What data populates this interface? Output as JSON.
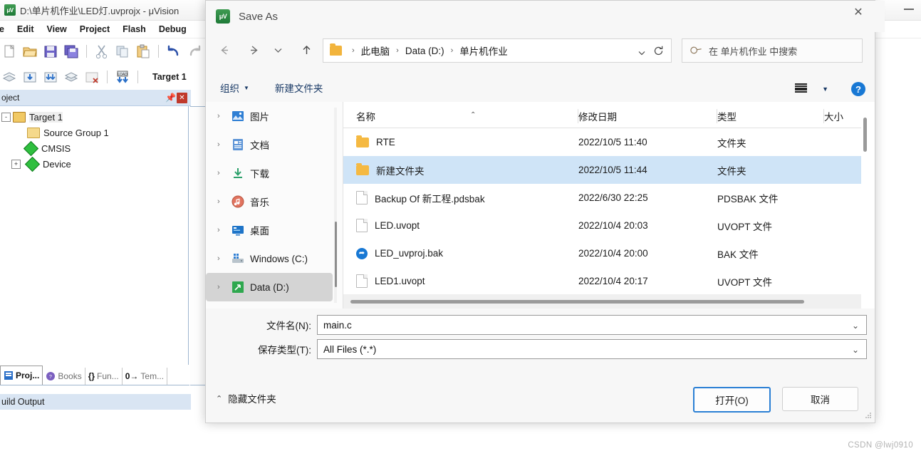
{
  "background_app": {
    "title": "D:\\单片机作业\\LED灯.uvprojx - μVision",
    "icon": "keil-uvision-icon",
    "minimize_label": "—",
    "menu": [
      "ile",
      "Edit",
      "View",
      "Project",
      "Flash",
      "Debug"
    ],
    "toolbar2_label": "Target 1",
    "project_panel": {
      "title": "oject",
      "pin_icon": "pin-icon",
      "close_icon": "close-icon",
      "tree": [
        {
          "label": "Target 1",
          "expander": "-",
          "icon": "target-folder-icon",
          "indent": 0,
          "selected": true
        },
        {
          "label": "Source Group 1",
          "expander": "",
          "icon": "folder-icon",
          "indent": 1,
          "selected": false
        },
        {
          "label": "CMSIS",
          "expander": "",
          "icon": "component-diamond-icon",
          "indent": 1,
          "selected": false
        },
        {
          "label": "Device",
          "expander": "+",
          "icon": "component-diamond-icon",
          "indent": 1,
          "selected": false
        }
      ]
    },
    "tabs": [
      {
        "label": "Proj...",
        "icon": "project-icon",
        "active": true
      },
      {
        "label": "Books",
        "icon": "books-icon",
        "active": false
      },
      {
        "label": "Fun...",
        "icon": "functions-icon",
        "active": false
      },
      {
        "label": "Tem...",
        "icon": "templates-icon",
        "active": false
      }
    ],
    "build_output_label": "uild Output"
  },
  "dialog": {
    "title": "Save As",
    "icon": "keil-uvision-icon",
    "close_icon": "close-icon",
    "nav": {
      "back_icon": "arrow-left-icon",
      "forward_icon": "arrow-right-icon",
      "recent_icon": "chevron-down-icon",
      "up_icon": "arrow-up-icon"
    },
    "address": {
      "folder_icon": "folder-icon",
      "crumbs": [
        "此电脑",
        "Data (D:)",
        "单片机作业"
      ],
      "separator": "›",
      "dropdown_icon": "chevron-down-icon",
      "refresh_icon": "refresh-icon"
    },
    "search": {
      "icon": "search-icon",
      "placeholder": "在 单片机作业 中搜索"
    },
    "commandbar": {
      "organize_label": "组织",
      "organize_caret": "▼",
      "new_folder_label": "新建文件夹",
      "view_icon": "view-list-icon",
      "view_caret": "▼",
      "help_icon": "help-icon",
      "help_label": "?"
    },
    "navpane": {
      "items": [
        {
          "label": "图片",
          "icon": "pictures-icon",
          "chevron": "›",
          "selected": false
        },
        {
          "label": "文档",
          "icon": "documents-icon",
          "chevron": "›",
          "selected": false
        },
        {
          "label": "下载",
          "icon": "downloads-icon",
          "chevron": "›",
          "selected": false
        },
        {
          "label": "音乐",
          "icon": "music-icon",
          "chevron": "›",
          "selected": false
        },
        {
          "label": "桌面",
          "icon": "desktop-icon",
          "chevron": "›",
          "selected": false
        },
        {
          "label": "Windows (C:)",
          "icon": "drive-icon",
          "chevron": "›",
          "selected": false
        },
        {
          "label": "Data (D:)",
          "icon": "drive-green-icon",
          "chevron": "›",
          "selected": true
        }
      ]
    },
    "filelist": {
      "columns": [
        "名称",
        "修改日期",
        "类型",
        "大小"
      ],
      "sort_caret": "⌃",
      "rows": [
        {
          "name": "RTE",
          "date": "2022/10/5 11:40",
          "type": "文件夹",
          "size": "",
          "icon": "folder-icon",
          "selected": false
        },
        {
          "name": "新建文件夹",
          "date": "2022/10/5 11:44",
          "type": "文件夹",
          "size": "",
          "icon": "folder-icon",
          "selected": true
        },
        {
          "name": "Backup Of 新工程.pdsbak",
          "date": "2022/6/30 22:25",
          "type": "PDSBAK 文件",
          "size": "",
          "icon": "file-icon",
          "selected": false
        },
        {
          "name": "LED.uvopt",
          "date": "2022/10/4 20:03",
          "type": "UVOPT 文件",
          "size": "",
          "icon": "file-icon",
          "selected": false
        },
        {
          "name": "LED_uvproj.bak",
          "date": "2022/10/4 20:00",
          "type": "BAK 文件",
          "size": "",
          "icon": "bak-icon",
          "selected": false
        },
        {
          "name": "LED1.uvopt",
          "date": "2022/10/4 20:17",
          "type": "UVOPT 文件",
          "size": "",
          "icon": "file-icon",
          "selected": false
        }
      ]
    },
    "form": {
      "filename_label": "文件名(N):",
      "filename_value": "main.c",
      "filename_caret": "⌄",
      "savetype_label": "保存类型(T):",
      "savetype_value": "All Files (*.*)",
      "savetype_caret": "⌄"
    },
    "footer": {
      "hide_folders_caret": "⌃",
      "hide_folders_label": "隐藏文件夹",
      "open_button": "打开(O)",
      "cancel_button": "取消"
    }
  },
  "watermark": "CSDN @lwj0910",
  "colors": {
    "accent": "#1878d4",
    "selection": "#cfe4f7",
    "dialog_bg": "#f7f7f7",
    "keil_panel_header": "#d9e5f3"
  }
}
